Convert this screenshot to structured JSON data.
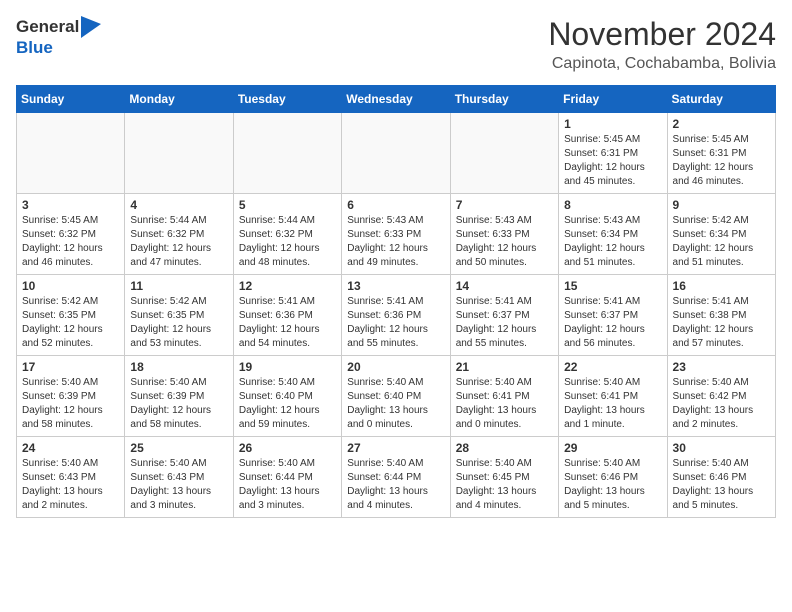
{
  "header": {
    "logo_general": "General",
    "logo_blue": "Blue",
    "month_title": "November 2024",
    "location": "Capinota, Cochabamba, Bolivia"
  },
  "weekdays": [
    "Sunday",
    "Monday",
    "Tuesday",
    "Wednesday",
    "Thursday",
    "Friday",
    "Saturday"
  ],
  "weeks": [
    [
      {
        "day": "",
        "info": ""
      },
      {
        "day": "",
        "info": ""
      },
      {
        "day": "",
        "info": ""
      },
      {
        "day": "",
        "info": ""
      },
      {
        "day": "",
        "info": ""
      },
      {
        "day": "1",
        "info": "Sunrise: 5:45 AM\nSunset: 6:31 PM\nDaylight: 12 hours\nand 45 minutes."
      },
      {
        "day": "2",
        "info": "Sunrise: 5:45 AM\nSunset: 6:31 PM\nDaylight: 12 hours\nand 46 minutes."
      }
    ],
    [
      {
        "day": "3",
        "info": "Sunrise: 5:45 AM\nSunset: 6:32 PM\nDaylight: 12 hours\nand 46 minutes."
      },
      {
        "day": "4",
        "info": "Sunrise: 5:44 AM\nSunset: 6:32 PM\nDaylight: 12 hours\nand 47 minutes."
      },
      {
        "day": "5",
        "info": "Sunrise: 5:44 AM\nSunset: 6:32 PM\nDaylight: 12 hours\nand 48 minutes."
      },
      {
        "day": "6",
        "info": "Sunrise: 5:43 AM\nSunset: 6:33 PM\nDaylight: 12 hours\nand 49 minutes."
      },
      {
        "day": "7",
        "info": "Sunrise: 5:43 AM\nSunset: 6:33 PM\nDaylight: 12 hours\nand 50 minutes."
      },
      {
        "day": "8",
        "info": "Sunrise: 5:43 AM\nSunset: 6:34 PM\nDaylight: 12 hours\nand 51 minutes."
      },
      {
        "day": "9",
        "info": "Sunrise: 5:42 AM\nSunset: 6:34 PM\nDaylight: 12 hours\nand 51 minutes."
      }
    ],
    [
      {
        "day": "10",
        "info": "Sunrise: 5:42 AM\nSunset: 6:35 PM\nDaylight: 12 hours\nand 52 minutes."
      },
      {
        "day": "11",
        "info": "Sunrise: 5:42 AM\nSunset: 6:35 PM\nDaylight: 12 hours\nand 53 minutes."
      },
      {
        "day": "12",
        "info": "Sunrise: 5:41 AM\nSunset: 6:36 PM\nDaylight: 12 hours\nand 54 minutes."
      },
      {
        "day": "13",
        "info": "Sunrise: 5:41 AM\nSunset: 6:36 PM\nDaylight: 12 hours\nand 55 minutes."
      },
      {
        "day": "14",
        "info": "Sunrise: 5:41 AM\nSunset: 6:37 PM\nDaylight: 12 hours\nand 55 minutes."
      },
      {
        "day": "15",
        "info": "Sunrise: 5:41 AM\nSunset: 6:37 PM\nDaylight: 12 hours\nand 56 minutes."
      },
      {
        "day": "16",
        "info": "Sunrise: 5:41 AM\nSunset: 6:38 PM\nDaylight: 12 hours\nand 57 minutes."
      }
    ],
    [
      {
        "day": "17",
        "info": "Sunrise: 5:40 AM\nSunset: 6:39 PM\nDaylight: 12 hours\nand 58 minutes."
      },
      {
        "day": "18",
        "info": "Sunrise: 5:40 AM\nSunset: 6:39 PM\nDaylight: 12 hours\nand 58 minutes."
      },
      {
        "day": "19",
        "info": "Sunrise: 5:40 AM\nSunset: 6:40 PM\nDaylight: 12 hours\nand 59 minutes."
      },
      {
        "day": "20",
        "info": "Sunrise: 5:40 AM\nSunset: 6:40 PM\nDaylight: 13 hours\nand 0 minutes."
      },
      {
        "day": "21",
        "info": "Sunrise: 5:40 AM\nSunset: 6:41 PM\nDaylight: 13 hours\nand 0 minutes."
      },
      {
        "day": "22",
        "info": "Sunrise: 5:40 AM\nSunset: 6:41 PM\nDaylight: 13 hours\nand 1 minute."
      },
      {
        "day": "23",
        "info": "Sunrise: 5:40 AM\nSunset: 6:42 PM\nDaylight: 13 hours\nand 2 minutes."
      }
    ],
    [
      {
        "day": "24",
        "info": "Sunrise: 5:40 AM\nSunset: 6:43 PM\nDaylight: 13 hours\nand 2 minutes."
      },
      {
        "day": "25",
        "info": "Sunrise: 5:40 AM\nSunset: 6:43 PM\nDaylight: 13 hours\nand 3 minutes."
      },
      {
        "day": "26",
        "info": "Sunrise: 5:40 AM\nSunset: 6:44 PM\nDaylight: 13 hours\nand 3 minutes."
      },
      {
        "day": "27",
        "info": "Sunrise: 5:40 AM\nSunset: 6:44 PM\nDaylight: 13 hours\nand 4 minutes."
      },
      {
        "day": "28",
        "info": "Sunrise: 5:40 AM\nSunset: 6:45 PM\nDaylight: 13 hours\nand 4 minutes."
      },
      {
        "day": "29",
        "info": "Sunrise: 5:40 AM\nSunset: 6:46 PM\nDaylight: 13 hours\nand 5 minutes."
      },
      {
        "day": "30",
        "info": "Sunrise: 5:40 AM\nSunset: 6:46 PM\nDaylight: 13 hours\nand 5 minutes."
      }
    ]
  ]
}
